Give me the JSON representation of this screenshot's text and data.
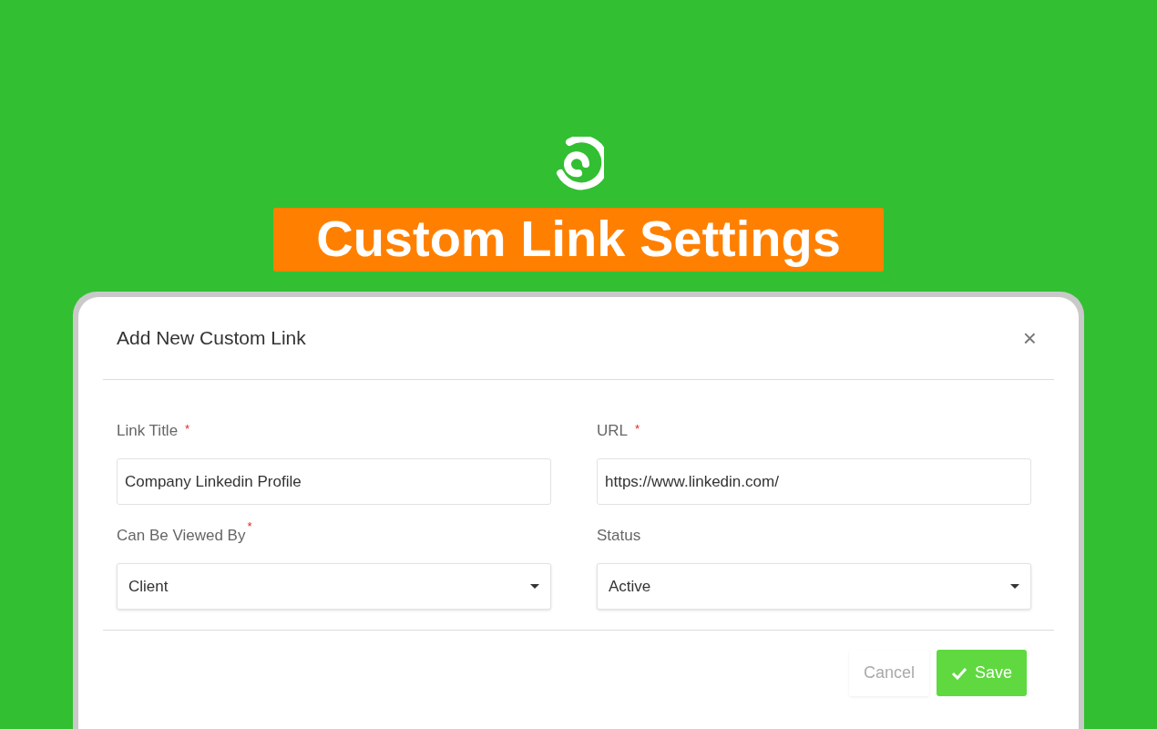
{
  "banner": {
    "title": "Custom Link Settings"
  },
  "dialog": {
    "title": "Add New Custom Link",
    "close": "×",
    "fields": [
      {
        "kind": "text",
        "label": "Link Title",
        "required_mark": "*",
        "value": "Company Linkedin Profile"
      },
      {
        "kind": "text",
        "label": "URL",
        "required_mark": "*",
        "value": "https://www.linkedin.com/"
      },
      {
        "kind": "select",
        "label": "Can Be Viewed By",
        "required_mark": "*",
        "value": "Client"
      },
      {
        "kind": "select",
        "label": "Status",
        "value": "Active"
      }
    ],
    "buttons": [
      {
        "kind": "secondary",
        "label": "Cancel"
      },
      {
        "kind": "primary",
        "label": "Save"
      }
    ]
  }
}
